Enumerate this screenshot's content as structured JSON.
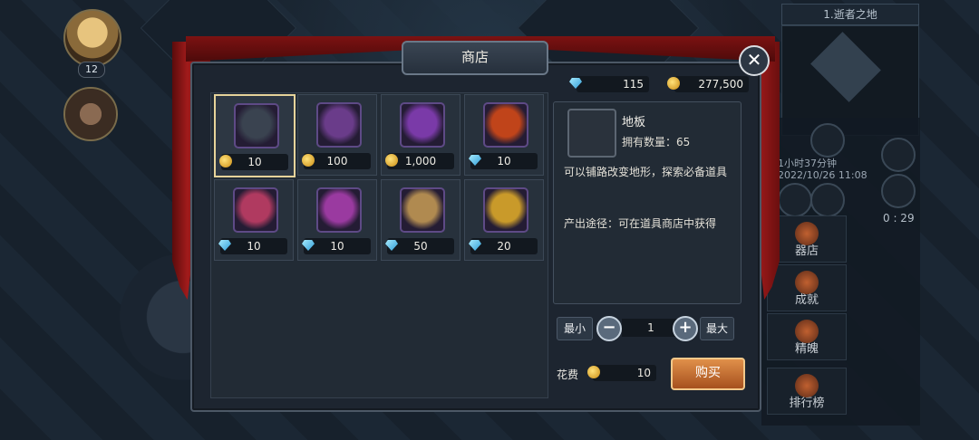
{
  "map": {
    "location_title": "1.逝者之地"
  },
  "player": {
    "level": "12"
  },
  "right_hud": {
    "timer_text": "1小时37分钟",
    "date_text": "2022/10/26 11:08",
    "countdown": "0 : 29",
    "buttons": [
      {
        "label": "器店",
        "icon": "shop-icon"
      },
      {
        "label": "成就",
        "icon": "achievement-icon"
      },
      {
        "label": "精魄",
        "icon": "spirit-icon"
      },
      {
        "label": "排行榜",
        "icon": "ranking-icon"
      }
    ]
  },
  "shop": {
    "title": "商店",
    "close_icon": "close-icon",
    "currency": {
      "gems": "115",
      "gold": "277,500"
    },
    "items": [
      {
        "price": "10",
        "currency": "coin",
        "icon": "floor-block-icon",
        "color": "#3a4350"
      },
      {
        "price": "100",
        "currency": "coin",
        "icon": "hourglass-icon",
        "color": "#6a3c8a"
      },
      {
        "price": "1,000",
        "currency": "coin",
        "icon": "purple-crystal-icon",
        "color": "#7a3aa8"
      },
      {
        "price": "10",
        "currency": "gem",
        "icon": "fire-stone-icon",
        "color": "#c0441a"
      },
      {
        "price": "10",
        "currency": "gem",
        "icon": "red-scroll-icon",
        "color": "#b03a60"
      },
      {
        "price": "10",
        "currency": "gem",
        "icon": "purple-scroll-icon",
        "color": "#9a3aa0"
      },
      {
        "price": "50",
        "currency": "gem",
        "icon": "map-scroll-icon",
        "color": "#b08a50"
      },
      {
        "price": "20",
        "currency": "gem",
        "icon": "treasure-chest-icon",
        "color": "#c99a2a"
      }
    ],
    "detail": {
      "name": "地板",
      "owned": "拥有数量：65",
      "description": "可以铺路改变地形，探索必备道具",
      "source": "产出途径：可在道具商店中获得"
    },
    "quantity": {
      "min_label": "最小",
      "max_label": "最大",
      "value": "1",
      "minus": "−",
      "plus": "+"
    },
    "cost": {
      "label": "花费",
      "value": "10"
    },
    "buy_label": "购买"
  }
}
